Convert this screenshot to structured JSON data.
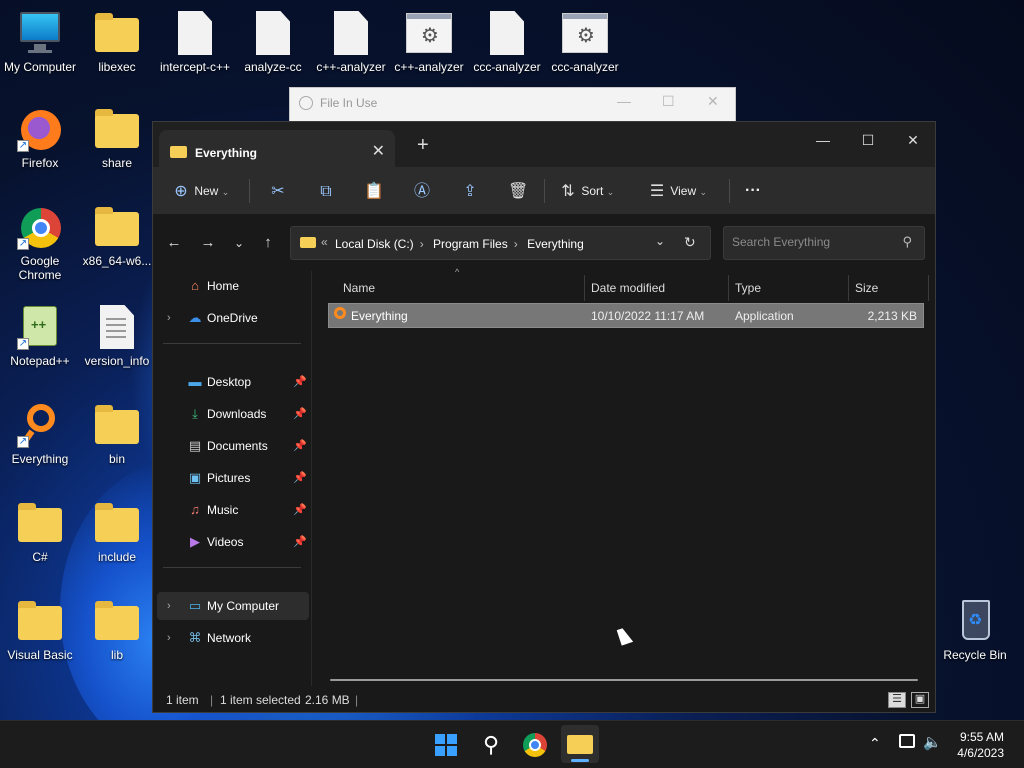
{
  "desktop": {
    "icons": [
      {
        "label": "My Computer"
      },
      {
        "label": "libexec"
      },
      {
        "label": "intercept-c++"
      },
      {
        "label": "analyze-cc"
      },
      {
        "label": "c++-analyzer"
      },
      {
        "label": "c++-analyzer"
      },
      {
        "label": "ccc-analyzer"
      },
      {
        "label": "ccc-analyzer"
      },
      {
        "label": "Firefox"
      },
      {
        "label": "share"
      },
      {
        "label": "Google Chrome"
      },
      {
        "label": "x86_64-w6..."
      },
      {
        "label": "Notepad++"
      },
      {
        "label": "version_info"
      },
      {
        "label": "Everything"
      },
      {
        "label": "bin"
      },
      {
        "label": "C#"
      },
      {
        "label": "include"
      },
      {
        "label": "Visual Basic"
      },
      {
        "label": "lib"
      },
      {
        "label": "Recycle Bin"
      }
    ]
  },
  "bg_window": {
    "title": "File In Use"
  },
  "explorer": {
    "tab_title": "Everything",
    "toolbar": {
      "new_label": "New",
      "sort_label": "Sort",
      "view_label": "View",
      "more_label": "···"
    },
    "breadcrumb": [
      "Local Disk (C:)",
      "Program Files",
      "Everything"
    ],
    "search_placeholder": "Search Everything",
    "sidebar": [
      {
        "label": "Home",
        "icon": "home-icon"
      },
      {
        "label": "OneDrive",
        "icon": "cloud-icon"
      },
      {
        "label": "Desktop",
        "icon": "desktop-icon"
      },
      {
        "label": "Downloads",
        "icon": "download-icon"
      },
      {
        "label": "Documents",
        "icon": "document-icon"
      },
      {
        "label": "Pictures",
        "icon": "picture-icon"
      },
      {
        "label": "Music",
        "icon": "music-icon"
      },
      {
        "label": "Videos",
        "icon": "video-icon"
      },
      {
        "label": "My Computer",
        "icon": "computer-icon"
      },
      {
        "label": "Network",
        "icon": "network-icon"
      }
    ],
    "columns": [
      "Name",
      "Date modified",
      "Type",
      "Size"
    ],
    "rows": [
      {
        "name": "Everything",
        "date": "10/10/2022 11:17 AM",
        "type": "Application",
        "size": "2,213 KB"
      }
    ],
    "status": {
      "count": "1 item",
      "selected": "1 item selected",
      "size": "2.16 MB"
    }
  },
  "taskbar": {
    "time": "9:55 AM",
    "date": "4/6/2023"
  }
}
